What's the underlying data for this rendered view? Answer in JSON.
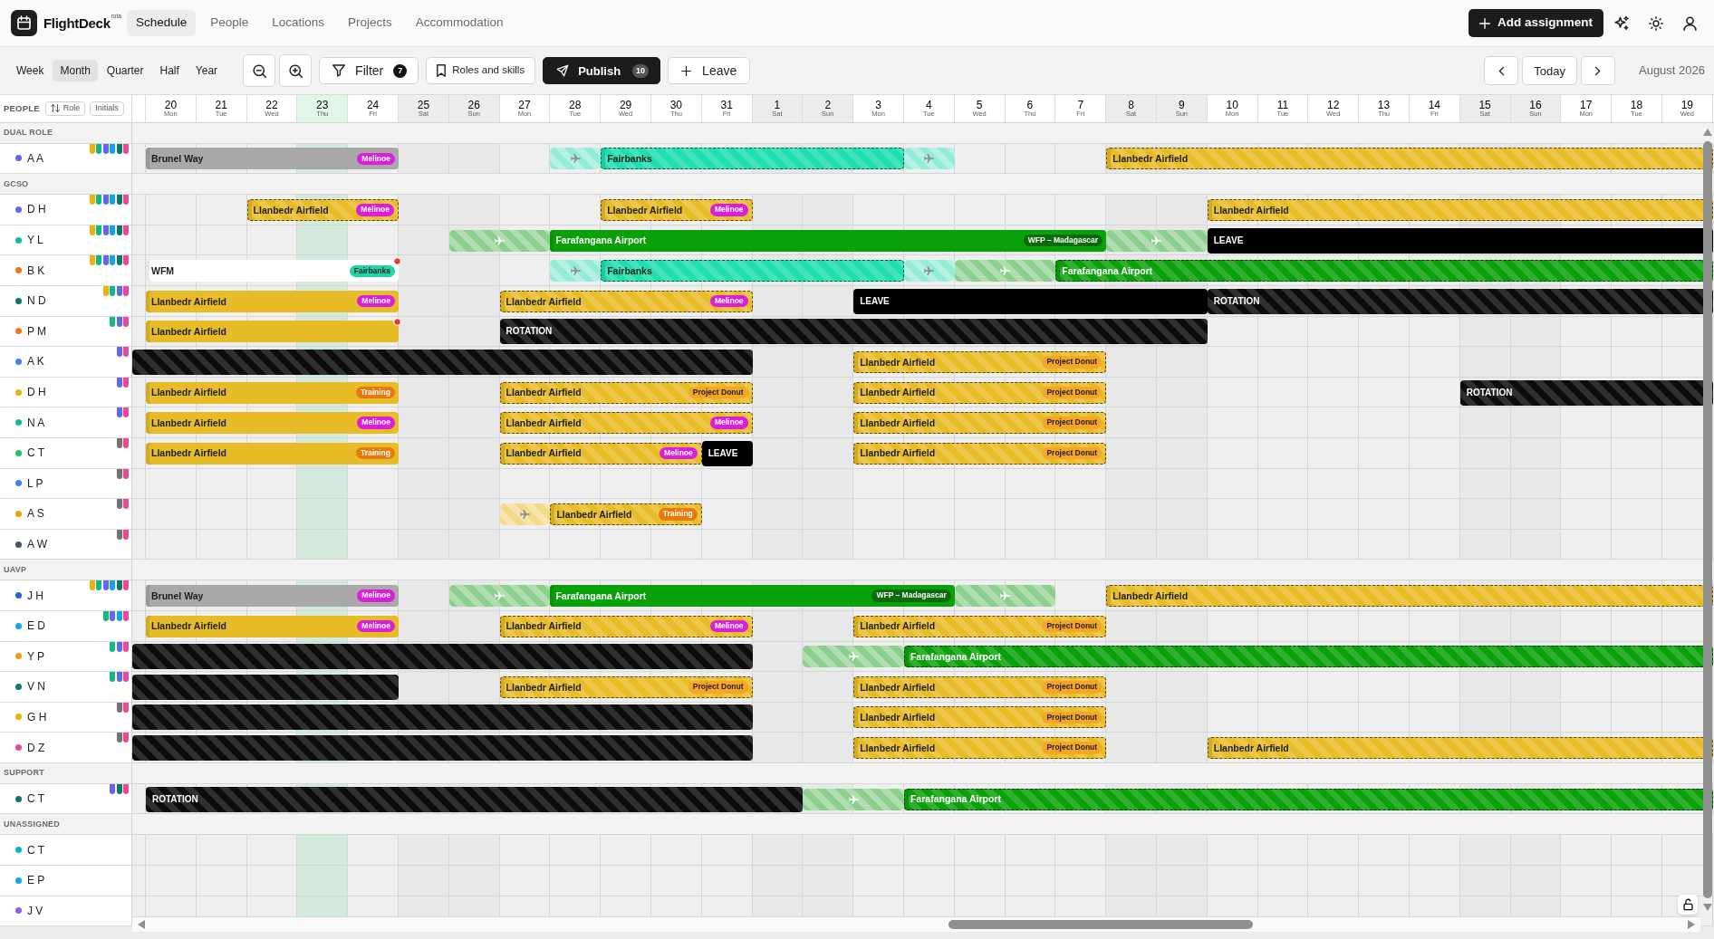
{
  "app": {
    "name": "FlightDeck",
    "badge": "rota"
  },
  "nav": [
    {
      "label": "Schedule",
      "selected": true
    },
    {
      "label": "People",
      "selected": false
    },
    {
      "label": "Locations",
      "selected": false
    },
    {
      "label": "Projects",
      "selected": false
    },
    {
      "label": "Accommodation",
      "selected": false
    }
  ],
  "header_actions": {
    "add_assignment": "Add assignment"
  },
  "toolbar": {
    "views": [
      {
        "label": "Week",
        "selected": false
      },
      {
        "label": "Month",
        "selected": true
      },
      {
        "label": "Quarter",
        "selected": false
      },
      {
        "label": "Half",
        "selected": false
      },
      {
        "label": "Year",
        "selected": false
      }
    ],
    "filter": {
      "label": "Filter",
      "count": "7"
    },
    "roles_and_skills": "Roles and skills",
    "publish": {
      "label": "Publish",
      "count": "10"
    },
    "leave": "Leave",
    "today": "Today",
    "period": "August 2026"
  },
  "people_column": {
    "title": "PEOPLE",
    "sort": "Role",
    "initials": "Initials"
  },
  "timeline": {
    "days": [
      {
        "day": "20",
        "weekday": "Mon",
        "weekend": false,
        "today": false
      },
      {
        "day": "21",
        "weekday": "Tue",
        "weekend": false,
        "today": false
      },
      {
        "day": "22",
        "weekday": "Wed",
        "weekend": false,
        "today": false
      },
      {
        "day": "23",
        "weekday": "Thu",
        "weekend": false,
        "today": true
      },
      {
        "day": "24",
        "weekday": "Fri",
        "weekend": false,
        "today": false
      },
      {
        "day": "25",
        "weekday": "Sat",
        "weekend": true,
        "today": false
      },
      {
        "day": "26",
        "weekday": "Sun",
        "weekend": true,
        "today": false
      },
      {
        "day": "27",
        "weekday": "Mon",
        "weekend": false,
        "today": false
      },
      {
        "day": "28",
        "weekday": "Tue",
        "weekend": false,
        "today": false
      },
      {
        "day": "29",
        "weekday": "Wed",
        "weekend": false,
        "today": false
      },
      {
        "day": "30",
        "weekday": "Thu",
        "weekend": false,
        "today": false
      },
      {
        "day": "31",
        "weekday": "Fri",
        "weekend": false,
        "today": false
      },
      {
        "day": "1",
        "weekday": "Sat",
        "weekend": true,
        "today": false
      },
      {
        "day": "2",
        "weekday": "Sun",
        "weekend": true,
        "today": false
      },
      {
        "day": "3",
        "weekday": "Mon",
        "weekend": false,
        "today": false
      },
      {
        "day": "4",
        "weekday": "Tue",
        "weekend": false,
        "today": false
      },
      {
        "day": "5",
        "weekday": "Wed",
        "weekend": false,
        "today": false
      },
      {
        "day": "6",
        "weekday": "Thu",
        "weekend": false,
        "today": false
      },
      {
        "day": "7",
        "weekday": "Fri",
        "weekend": false,
        "today": false
      },
      {
        "day": "8",
        "weekday": "Sat",
        "weekend": true,
        "today": false
      },
      {
        "day": "9",
        "weekday": "Sun",
        "weekend": true,
        "today": false
      },
      {
        "day": "10",
        "weekday": "Mon",
        "weekend": false,
        "today": false
      },
      {
        "day": "11",
        "weekday": "Tue",
        "weekend": false,
        "today": false
      },
      {
        "day": "12",
        "weekday": "Wed",
        "weekend": false,
        "today": false
      },
      {
        "day": "13",
        "weekday": "Thu",
        "weekend": false,
        "today": false
      },
      {
        "day": "14",
        "weekday": "Fri",
        "weekend": false,
        "today": false
      },
      {
        "day": "15",
        "weekday": "Sat",
        "weekend": true,
        "today": false
      },
      {
        "day": "16",
        "weekday": "Sun",
        "weekend": true,
        "today": false
      },
      {
        "day": "17",
        "weekday": "Mon",
        "weekend": false,
        "today": false
      },
      {
        "day": "18",
        "weekday": "Tue",
        "weekend": false,
        "today": false
      },
      {
        "day": "19",
        "weekday": "Wed",
        "weekend": false,
        "today": false
      }
    ]
  },
  "groups": [
    {
      "name": "DUAL ROLE",
      "people": [
        {
          "initials": "A A",
          "color": "#6366f1",
          "skills": [
            {
              "color": "#eab308"
            },
            {
              "color": "#10b981"
            },
            {
              "color": "#6366f1"
            },
            {
              "color": "#0ea5e9"
            },
            {
              "color": "#0f766e"
            },
            {
              "color": "#ec4899"
            }
          ],
          "assignments": [
            {
              "kind": "location",
              "label": "Brunel Way",
              "span": [
                false,
                true,
                true,
                true,
                true,
                true
              ],
              "color": "#a8a8a8",
              "tentative": false,
              "tag": {
                "label": "Melinoe",
                "color": "#dc1edc"
              }
            },
            {
              "kind": "travel",
              "span": [
                false,
                false,
                false,
                true
              ],
              "color": "#93ecd5"
            },
            {
              "kind": "location",
              "label": "Fairbanks",
              "span": [
                true,
                true,
                true,
                true,
                true,
                true
              ],
              "color": "#1fdfae",
              "tentative": true
            },
            {
              "kind": "travel",
              "span": [
                true
              ],
              "color": "#93ecd5"
            },
            {
              "kind": "location",
              "label": "Llanbedr Airfield",
              "span": [
                false,
                false,
                false,
                true,
                true,
                true,
                true,
                true,
                true,
                true,
                true,
                true,
                true,
                true,
                true
              ],
              "color": "#e8bc27",
              "tentative": true
            }
          ]
        }
      ]
    },
    {
      "name": "GCSO",
      "people": [
        {
          "initials": "D H",
          "color": "#6366f1",
          "skills": [
            {
              "color": "#eab308"
            },
            {
              "color": "#10b981"
            },
            {
              "color": "#6366f1"
            },
            {
              "color": "#0ea5e9"
            },
            {
              "color": "#0f766e"
            },
            {
              "color": "#ec4899"
            }
          ],
          "assignments": [
            {
              "kind": "location",
              "label": "Llanbedr Airfield",
              "span": [
                false,
                false,
                false,
                true,
                true,
                true
              ],
              "color": "#e8bc27",
              "tentative": true,
              "tag": {
                "label": "Melinoe",
                "color": "#dc1edc"
              }
            },
            {
              "kind": "location",
              "label": "Llanbedr Airfield",
              "span": [
                false,
                false,
                false,
                false,
                true,
                true,
                true
              ],
              "color": "#e8bc27",
              "tentative": true,
              "tag": {
                "label": "Melinoe",
                "color": "#dc1edc"
              }
            },
            {
              "kind": "location",
              "label": "Llanbedr Airfield",
              "span": [
                false,
                false,
                false,
                false,
                false,
                false,
                false,
                false,
                false,
                true,
                true,
                true,
                true,
                true,
                true,
                true,
                true,
                true,
                true
              ],
              "color": "#e8bc27",
              "tentative": true
            }
          ]
        },
        {
          "initials": "Y L",
          "color": "#14b8a6",
          "skills": [
            {
              "color": "#eab308"
            },
            {
              "color": "#10b981"
            },
            {
              "color": "#6366f1"
            },
            {
              "color": "#0ea5e9"
            },
            {
              "color": "#0f766e"
            },
            {
              "color": "#ec4899"
            }
          ],
          "assignments": [
            {
              "kind": "travel",
              "span": [
                false,
                false,
                false,
                false,
                false,
                false,
                false,
                true,
                true
              ],
              "color": "#8ccf8c"
            },
            {
              "kind": "location",
              "label": "Farafangana Airport",
              "span": [
                true,
                true,
                true,
                true,
                true,
                true,
                true,
                true,
                true,
                true,
                true
              ],
              "color": "#0aa00a",
              "tentative": false,
              "tag": {
                "label": "WFP – Madagascar",
                "color": "#0b6b0b"
              }
            },
            {
              "kind": "travel",
              "span": [
                true,
                true
              ],
              "color": "#8ccf8c"
            },
            {
              "kind": "leave",
              "label": "LEAVE",
              "span": [
                true,
                true,
                true,
                true,
                true,
                true,
                true,
                true,
                true,
                true
              ]
            }
          ]
        },
        {
          "initials": "B K",
          "color": "#f97316",
          "skills": [
            {
              "color": "#eab308"
            },
            {
              "color": "#10b981"
            },
            {
              "color": "#6366f1"
            },
            {
              "color": "#0ea5e9"
            },
            {
              "color": "#0f766e"
            },
            {
              "color": "#ec4899"
            }
          ],
          "assignments": [
            {
              "kind": "location",
              "label": "WFM",
              "span": [
                false,
                true,
                true,
                true,
                true,
                true
              ],
              "color": "#ffffff",
              "tentative": false,
              "tag": {
                "label": "Fairbanks",
                "color": "#20d6a6"
              },
              "flagged": true
            },
            {
              "kind": "travel",
              "span": [
                false,
                false,
                false,
                true
              ],
              "color": "#93ecd5"
            },
            {
              "kind": "location",
              "label": "Fairbanks",
              "span": [
                true,
                true,
                true,
                true,
                true,
                true
              ],
              "color": "#1fdfae",
              "tentative": true
            },
            {
              "kind": "travel",
              "span": [
                true
              ],
              "color": "#93ecd5"
            },
            {
              "kind": "travel",
              "span": [
                true,
                true
              ],
              "color": "#8ccf8c"
            },
            {
              "kind": "location",
              "label": "Farafangana Airport",
              "span": [
                true,
                true,
                true,
                true,
                true,
                true,
                true,
                true,
                true,
                true,
                true,
                true,
                true
              ],
              "color": "#0aa00a",
              "tentative": true
            }
          ]
        },
        {
          "initials": "N D",
          "color": "#0f766e",
          "skills": [
            {
              "color": "#eab308"
            },
            {
              "color": "#10b981"
            },
            {
              "color": "#6366f1"
            },
            {
              "color": "#ec4899"
            }
          ],
          "assignments": [
            {
              "kind": "location",
              "label": "Llanbedr Airfield",
              "span": [
                false,
                true,
                true,
                true,
                true,
                true
              ],
              "color": "#e8bc27",
              "tentative": false,
              "tag": {
                "label": "Melinoe",
                "color": "#dc1edc"
              }
            },
            {
              "kind": "location",
              "label": "Llanbedr Airfield",
              "span": [
                false,
                false,
                true,
                true,
                true,
                true,
                true
              ],
              "color": "#e8bc27",
              "tentative": true,
              "tag": {
                "label": "Melinoe",
                "color": "#dc1edc"
              }
            },
            {
              "kind": "leave",
              "label": "LEAVE",
              "span": [
                false,
                false,
                true,
                true,
                true,
                true,
                true,
                true,
                true
              ]
            },
            {
              "kind": "rotation",
              "label": "ROTATION",
              "span": [
                true,
                true,
                true,
                true,
                true,
                true,
                true,
                true,
                true,
                true
              ]
            }
          ]
        },
        {
          "initials": "P M",
          "color": "#f97316",
          "skills": [
            {
              "color": "#10b981"
            },
            {
              "color": "#6366f1"
            },
            {
              "color": "#ec4899"
            }
          ],
          "assignments": [
            {
              "kind": "location",
              "label": "Llanbedr Airfield",
              "span": [
                false,
                true,
                true,
                true,
                true,
                true
              ],
              "color": "#e8bc27",
              "tentative": false,
              "flagged": true
            },
            {
              "kind": "rotation",
              "label": "ROTATION",
              "span": [
                false,
                false,
                true,
                true,
                true,
                true,
                true,
                true,
                true,
                true,
                true,
                true,
                true,
                true,
                true,
                true
              ]
            }
          ]
        },
        {
          "initials": "A K",
          "color": "#3b82f6",
          "skills": [
            {
              "color": "#6366f1"
            },
            {
              "color": "#ec4899"
            }
          ],
          "assignments": [
            {
              "kind": "rotation",
              "span": [
                true,
                true,
                true,
                true,
                true,
                true,
                true,
                true,
                true,
                true,
                true,
                true,
                true
              ]
            },
            {
              "kind": "location",
              "label": "Llanbedr Airfield",
              "span": [
                false,
                false,
                true,
                true,
                true,
                true,
                true
              ],
              "color": "#e8bc27",
              "tentative": true,
              "tag": {
                "label": "Project Donut",
                "color": "#f7a526"
              }
            }
          ]
        },
        {
          "initials": "D H",
          "color": "#eab308",
          "skills": [
            {
              "color": "#6366f1"
            },
            {
              "color": "#ec4899"
            }
          ],
          "assignments": [
            {
              "kind": "location",
              "label": "Llanbedr Airfield",
              "span": [
                false,
                true,
                true,
                true,
                true,
                true
              ],
              "color": "#e8bc27",
              "tentative": false,
              "tag": {
                "label": "Training",
                "color": "#e87a0c"
              }
            },
            {
              "kind": "location",
              "label": "Llanbedr Airfield",
              "span": [
                false,
                false,
                true,
                true,
                true,
                true,
                true
              ],
              "color": "#e8bc27",
              "tentative": true,
              "tag": {
                "label": "Project Donut",
                "color": "#f7a526"
              }
            },
            {
              "kind": "location",
              "label": "Llanbedr Airfield",
              "span": [
                false,
                false,
                true,
                true,
                true,
                true,
                true
              ],
              "color": "#e8bc27",
              "tentative": true,
              "tag": {
                "label": "Project Donut",
                "color": "#f7a526"
              }
            },
            {
              "kind": "rotation",
              "label": "ROTATION",
              "span": [
                false,
                false,
                false,
                false,
                false,
                false,
                false,
                true,
                true,
                true,
                true,
                true
              ]
            }
          ]
        },
        {
          "initials": "N A",
          "color": "#14b8a6",
          "skills": [
            {
              "color": "#6366f1"
            },
            {
              "color": "#ec4899"
            }
          ],
          "assignments": [
            {
              "kind": "location",
              "label": "Llanbedr Airfield",
              "span": [
                false,
                true,
                true,
                true,
                true,
                true
              ],
              "color": "#e8bc27",
              "tentative": false,
              "tag": {
                "label": "Melinoe",
                "color": "#dc1edc"
              }
            },
            {
              "kind": "location",
              "label": "Llanbedr Airfield",
              "span": [
                false,
                false,
                true,
                true,
                true,
                true,
                true
              ],
              "color": "#e8bc27",
              "tentative": true,
              "tag": {
                "label": "Melinoe",
                "color": "#dc1edc"
              }
            },
            {
              "kind": "location",
              "label": "Llanbedr Airfield",
              "span": [
                false,
                false,
                true,
                true,
                true,
                true,
                true
              ],
              "color": "#e8bc27",
              "tentative": true,
              "tag": {
                "label": "Project Donut",
                "color": "#f7a526"
              }
            }
          ]
        },
        {
          "initials": "C T",
          "color": "#22c55e",
          "skills": [
            {
              "color": "#78716c"
            },
            {
              "color": "#ec4899"
            }
          ],
          "assignments": [
            {
              "kind": "location",
              "label": "Llanbedr Airfield",
              "span": [
                false,
                true,
                true,
                true,
                true,
                true
              ],
              "color": "#e8bc27",
              "tentative": false,
              "tag": {
                "label": "Training",
                "color": "#e87a0c"
              }
            },
            {
              "kind": "location",
              "label": "Llanbedr Airfield",
              "span": [
                false,
                false,
                true,
                true,
                true,
                true
              ],
              "color": "#e8bc27",
              "tentative": true,
              "tag": {
                "label": "Melinoe",
                "color": "#dc1edc"
              }
            },
            {
              "kind": "leave",
              "label": "LEAVE",
              "span": [
                true
              ]
            },
            {
              "kind": "location",
              "label": "Llanbedr Airfield",
              "span": [
                false,
                false,
                true,
                true,
                true,
                true,
                true
              ],
              "color": "#e8bc27",
              "tentative": true,
              "tag": {
                "label": "Project Donut",
                "color": "#f7a526"
              }
            }
          ]
        },
        {
          "initials": "L P",
          "color": "#3b82f6",
          "skills": [
            {
              "color": "#78716c"
            },
            {
              "color": "#ec4899"
            }
          ]
        },
        {
          "initials": "A S",
          "color": "#f59e0b",
          "skills": [
            {
              "color": "#78716c"
            },
            {
              "color": "#ec4899"
            }
          ],
          "assignments": [
            {
              "kind": "travel",
              "span": [
                false,
                false,
                false,
                false,
                false,
                false,
                false,
                false,
                true
              ],
              "color": "#f3d98a"
            },
            {
              "kind": "location",
              "label": "Llanbedr Airfield",
              "span": [
                true,
                true,
                true
              ],
              "color": "#e8bc27",
              "tentative": true,
              "tag": {
                "label": "Training",
                "color": "#e87a0c"
              }
            }
          ]
        },
        {
          "initials": "A W",
          "color": "#475569",
          "skills": [
            {
              "color": "#78716c"
            },
            {
              "color": "#ec4899"
            }
          ]
        }
      ]
    },
    {
      "name": "UAVP",
      "people": [
        {
          "initials": "J H",
          "color": "#2563eb",
          "skills": [
            {
              "color": "#eab308"
            },
            {
              "color": "#10b981"
            },
            {
              "color": "#6366f1"
            },
            {
              "color": "#0ea5e9"
            },
            {
              "color": "#0f766e"
            },
            {
              "color": "#ec4899"
            }
          ],
          "assignments": [
            {
              "kind": "location",
              "label": "Brunel Way",
              "span": [
                false,
                true,
                true,
                true,
                true,
                true
              ],
              "color": "#a8a8a8",
              "tentative": false,
              "tag": {
                "label": "Melinoe",
                "color": "#dc1edc"
              }
            },
            {
              "kind": "travel",
              "span": [
                false,
                true,
                true
              ],
              "color": "#8ccf8c"
            },
            {
              "kind": "location",
              "label": "Farafangana Airport",
              "span": [
                true,
                true,
                true,
                true,
                true,
                true,
                true,
                true
              ],
              "color": "#0aa00a",
              "tentative": false,
              "tag": {
                "label": "WFP – Madagascar",
                "color": "#0b6b0b"
              }
            },
            {
              "kind": "travel",
              "span": [
                true,
                true
              ],
              "color": "#8ccf8c"
            },
            {
              "kind": "location",
              "label": "Llanbedr Airfield",
              "span": [
                false,
                true,
                true,
                true,
                true,
                true,
                true,
                true,
                true,
                true,
                true,
                true,
                true
              ],
              "color": "#e8bc27",
              "tentative": true
            }
          ]
        },
        {
          "initials": "E D",
          "color": "#0ea5e9",
          "skills": [
            {
              "color": "#10b981"
            },
            {
              "color": "#6366f1"
            },
            {
              "color": "#0ea5e9"
            },
            {
              "color": "#ec4899"
            }
          ],
          "assignments": [
            {
              "kind": "location",
              "label": "Llanbedr Airfield",
              "span": [
                false,
                true,
                true,
                true,
                true,
                true
              ],
              "color": "#e8bc27",
              "tentative": false,
              "tag": {
                "label": "Melinoe",
                "color": "#dc1edc"
              }
            },
            {
              "kind": "location",
              "label": "Llanbedr Airfield",
              "span": [
                false,
                false,
                true,
                true,
                true,
                true,
                true
              ],
              "color": "#e8bc27",
              "tentative": true,
              "tag": {
                "label": "Melinoe",
                "color": "#dc1edc"
              }
            },
            {
              "kind": "location",
              "label": "Llanbedr Airfield",
              "span": [
                false,
                false,
                true,
                true,
                true,
                true,
                true
              ],
              "color": "#e8bc27",
              "tentative": true,
              "tag": {
                "label": "Project Donut",
                "color": "#f7a526"
              }
            }
          ]
        },
        {
          "initials": "Y P",
          "color": "#f59e0b",
          "skills": [
            {
              "color": "#10b981"
            },
            {
              "color": "#6366f1"
            },
            {
              "color": "#ec4899"
            }
          ],
          "assignments": [
            {
              "kind": "rotation",
              "span": [
                true,
                true,
                true,
                true,
                true,
                true,
                true,
                true,
                true,
                true,
                true,
                true,
                true
              ]
            },
            {
              "kind": "travel",
              "span": [
                false,
                true,
                true
              ],
              "color": "#8ccf8c"
            },
            {
              "kind": "location",
              "label": "Farafangana Airport",
              "span": [
                true,
                true,
                true,
                true,
                true,
                true,
                true,
                true,
                true,
                true,
                true,
                true,
                true,
                true,
                true,
                true
              ],
              "color": "#0aa00a",
              "tentative": true
            }
          ]
        },
        {
          "initials": "V N",
          "color": "#0f766e",
          "skills": [
            {
              "color": "#10b981"
            },
            {
              "color": "#6366f1"
            },
            {
              "color": "#ec4899"
            }
          ],
          "assignments": [
            {
              "kind": "rotation",
              "span": [
                true,
                true,
                true,
                true,
                true,
                true
              ]
            },
            {
              "kind": "location",
              "label": "Llanbedr Airfield",
              "span": [
                false,
                false,
                true,
                true,
                true,
                true,
                true
              ],
              "color": "#e8bc27",
              "tentative": true,
              "tag": {
                "label": "Project Donut",
                "color": "#f7a526"
              }
            },
            {
              "kind": "location",
              "label": "Llanbedr Airfield",
              "span": [
                false,
                false,
                true,
                true,
                true,
                true,
                true
              ],
              "color": "#e8bc27",
              "tentative": true,
              "tag": {
                "label": "Project Donut",
                "color": "#f7a526"
              }
            }
          ]
        },
        {
          "initials": "G H",
          "color": "#eab308",
          "skills": [
            {
              "color": "#78716c"
            },
            {
              "color": "#ec4899"
            }
          ],
          "assignments": [
            {
              "kind": "rotation",
              "span": [
                true,
                true,
                true,
                true,
                true,
                true,
                true,
                true,
                true,
                true,
                true,
                true,
                true
              ]
            },
            {
              "kind": "location",
              "label": "Llanbedr Airfield",
              "span": [
                false,
                false,
                true,
                true,
                true,
                true,
                true
              ],
              "color": "#e8bc27",
              "tentative": true,
              "tag": {
                "label": "Project Donut",
                "color": "#f7a526"
              }
            }
          ]
        },
        {
          "initials": "D Z",
          "color": "#ec4899",
          "skills": [
            {
              "color": "#78716c"
            },
            {
              "color": "#ec4899"
            }
          ],
          "assignments": [
            {
              "kind": "rotation",
              "span": [
                true,
                true,
                true,
                true,
                true,
                true,
                true,
                true,
                true,
                true,
                true,
                true,
                true
              ]
            },
            {
              "kind": "location",
              "label": "Llanbedr Airfield",
              "span": [
                false,
                false,
                true,
                true,
                true,
                true,
                true
              ],
              "color": "#e8bc27",
              "tentative": true,
              "tag": {
                "label": "Project Donut",
                "color": "#f7a526"
              }
            },
            {
              "kind": "location",
              "label": "Llanbedr Airfield",
              "span": [
                false,
                false,
                true,
                true,
                true,
                true,
                true,
                true,
                true,
                true,
                true,
                true
              ],
              "color": "#e8bc27",
              "tentative": true
            }
          ]
        }
      ]
    },
    {
      "name": "SUPPORT",
      "people": [
        {
          "initials": "C T",
          "color": "#0f766e",
          "skills": [
            {
              "color": "#6366f1"
            },
            {
              "color": "#0f766e"
            },
            {
              "color": "#ec4899"
            }
          ],
          "assignments": [
            {
              "kind": "rotation",
              "label": "ROTATION",
              "span": [
                false,
                true,
                true,
                true,
                true,
                true,
                true,
                true,
                true,
                true,
                true,
                true,
                true,
                true
              ]
            },
            {
              "kind": "travel",
              "span": [
                true,
                true
              ],
              "color": "#8ccf8c"
            },
            {
              "kind": "location",
              "label": "Farafangana Airport",
              "span": [
                true,
                true,
                true,
                true,
                true,
                true,
                true,
                true,
                true,
                true,
                true,
                true,
                true,
                true,
                true,
                true
              ],
              "color": "#0aa00a",
              "tentative": true
            }
          ]
        }
      ]
    },
    {
      "name": "UNASSIGNED",
      "people": [
        {
          "initials": "C T",
          "color": "#06b6d4"
        },
        {
          "initials": "E P",
          "color": "#0ea5e9"
        },
        {
          "initials": "J V",
          "color": "#8b5cf6"
        }
      ]
    }
  ]
}
